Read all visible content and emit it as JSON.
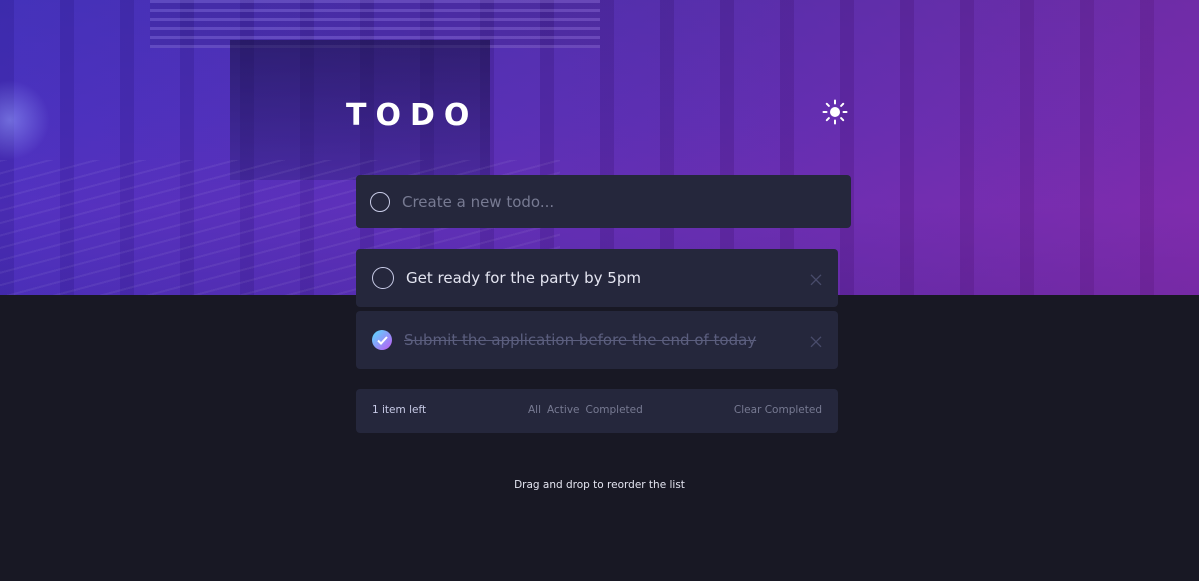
{
  "header": {
    "title": "TODO",
    "theme_icon": "sun-icon"
  },
  "new_todo": {
    "placeholder": "Create a new todo...",
    "value": ""
  },
  "todos": [
    {
      "text": "Get ready for the party by 5pm",
      "completed": false
    },
    {
      "text": "Submit the application before the end of today",
      "completed": true
    }
  ],
  "footer": {
    "items_left": "1 item left",
    "filters": [
      "All",
      "Active",
      "Completed"
    ],
    "clear_label": "Clear Completed"
  },
  "hint": "Drag and drop to reorder the list",
  "colors": {
    "page_bg": "#181824",
    "card_bg": "#25273c",
    "check_gradient_start": "#57ddff",
    "check_gradient_end": "#c058f3",
    "text_light": "#e4e5f1",
    "text_muted": "#777a92"
  }
}
